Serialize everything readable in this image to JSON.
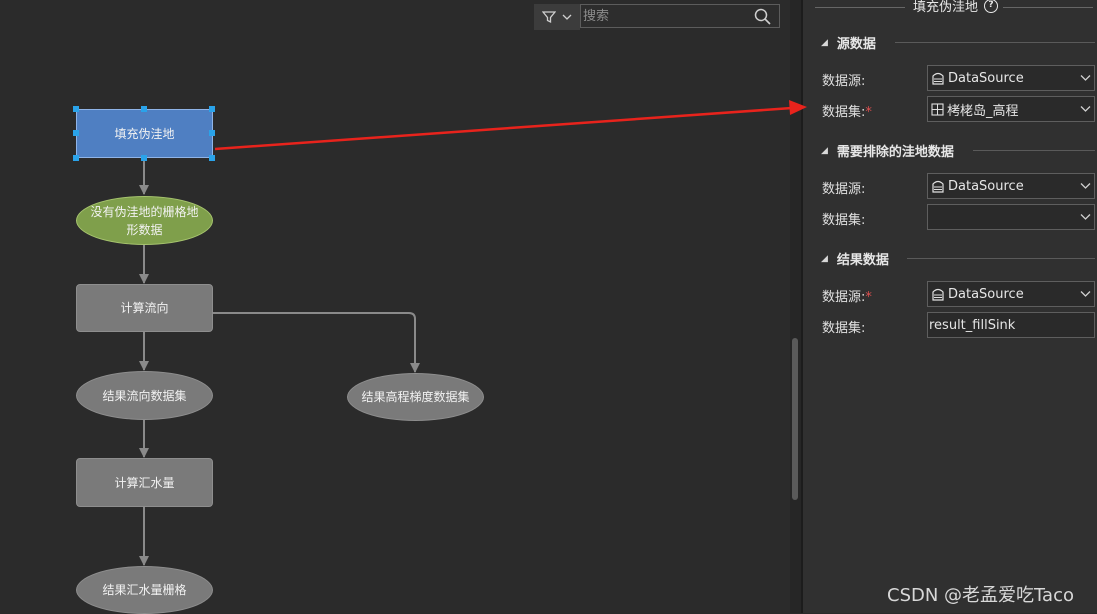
{
  "toolbar": {
    "search_placeholder": "搜索"
  },
  "nodes": {
    "fill_sink": "填充伪洼地",
    "input_dem_line1": "没有伪洼地的栅格地",
    "input_dem_line2": "形数据",
    "flow_direction": "计算流向",
    "result_flow_direction": "结果流向数据集",
    "result_slope": "结果高程梯度数据集",
    "flow_accumulation": "计算汇水量",
    "result_accumulation": "结果汇水量栅格"
  },
  "panel": {
    "title": "填充伪洼地",
    "sections": {
      "source": "源数据",
      "exclude": "需要排除的洼地数据",
      "result": "结果数据"
    },
    "source": {
      "datasource_label": "数据源:",
      "datasource_value": "DataSource",
      "dataset_label": "数据集:",
      "dataset_value": "栲栳岛_高程"
    },
    "exclude": {
      "datasource_label": "数据源:",
      "datasource_value": "DataSource",
      "dataset_label": "数据集:",
      "dataset_value": ""
    },
    "result": {
      "datasource_label": "数据源:",
      "datasource_value": "DataSource",
      "dataset_label": "数据集:",
      "dataset_value": "result_fillSink"
    },
    "required_mark": "*"
  },
  "watermark": "CSDN @老孟爱吃Taco",
  "colors": {
    "annotation_arrow": "#e8231c",
    "selection_handle": "#2aa3ea",
    "selected_node": "#4f7fc2",
    "input_node": "#7f9f4b"
  }
}
